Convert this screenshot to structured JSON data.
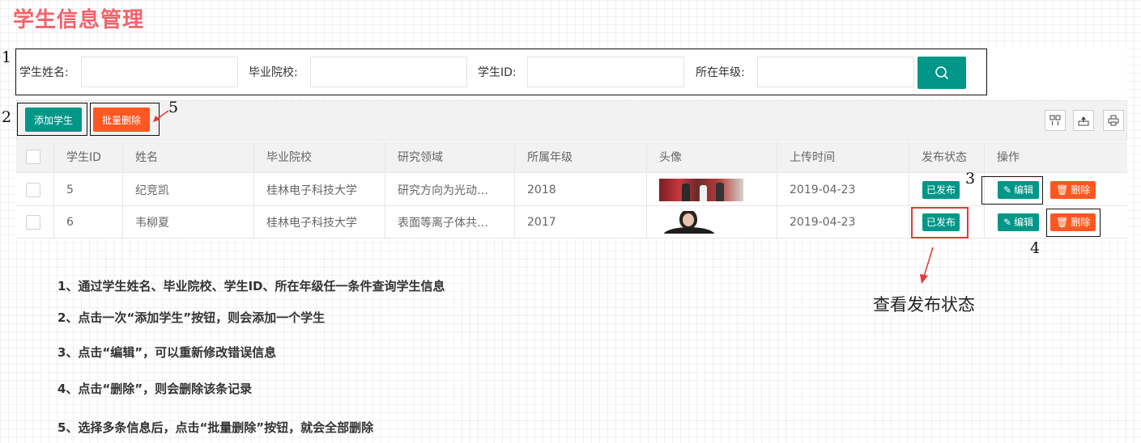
{
  "page": {
    "title": "学生信息管理"
  },
  "search": {
    "fields": [
      {
        "label": "学生姓名:",
        "value": "",
        "placeholder": ""
      },
      {
        "label": "毕业院校:",
        "value": "",
        "placeholder": ""
      },
      {
        "label": "学生ID:",
        "value": "",
        "placeholder": ""
      },
      {
        "label": "所在年级:",
        "value": "",
        "placeholder": ""
      }
    ],
    "button_icon": "search-icon"
  },
  "toolbar": {
    "add_label": "添加学生",
    "batch_delete_label": "批量删除",
    "right_icons": [
      "columns-icon",
      "export-icon",
      "print-icon"
    ]
  },
  "table": {
    "columns": [
      "学生ID",
      "姓名",
      "毕业院校",
      "研究领域",
      "所属年级",
      "头像",
      "上传时间",
      "发布状态",
      "操作"
    ],
    "rows": [
      {
        "id": "5",
        "name": "纪竞凯",
        "school": "桂林电子科技大学",
        "field": "研究方向为光动…",
        "grade": "2018",
        "avatar": "photo-group",
        "upload_time": "2019-04-23",
        "status": "已发布",
        "edit_label": "编辑",
        "delete_label": "删除"
      },
      {
        "id": "6",
        "name": "韦柳夏",
        "school": "桂林电子科技大学",
        "field": "表面等离子体共…",
        "grade": "2017",
        "avatar": "photo-portrait",
        "upload_time": "2019-04-23",
        "status": "已发布",
        "edit_label": "编辑",
        "delete_label": "删除"
      }
    ]
  },
  "annotations": {
    "numbers": [
      "1",
      "2",
      "3",
      "4",
      "5"
    ],
    "caption": "查看发布状态",
    "notes": [
      "1、通过学生姓名、毕业院校、学生ID、所在年级任一条件查询学生信息",
      "2、点击一次“添加学生”按钮，则会添加一个学生",
      "3、点击“编辑”，可以重新修改错误信息",
      "4、点击“删除”，则会删除该条记录",
      "5、选择多条信息后，点击“批量删除”按钮，就会全部删除"
    ]
  },
  "colors": {
    "title": "#f2636b",
    "primary": "#009688",
    "danger": "#ff5722",
    "highlight": "#e53935"
  }
}
